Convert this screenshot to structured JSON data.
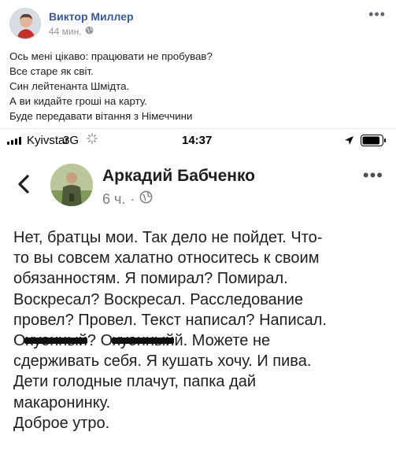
{
  "outer_post": {
    "author": "Виктор Миллер",
    "time": "44 мин.",
    "visibility_icon": "globe-icon",
    "more_icon": "more-horizontal-icon",
    "more_label": "•••",
    "lines": [
      "Ось мені цікаво: працювати не пробував?",
      "Все старе як світ.",
      "Син лейтенанта Шмідта.",
      "А ви кидайте гроші на карту.",
      "Буде передавати вітання з Німеччини"
    ]
  },
  "status_bar": {
    "carrier": "Kyivstar",
    "network": "3G",
    "time": "14:37",
    "signal_bars": 4,
    "battery_level": 0.9
  },
  "embedded_post": {
    "back_icon": "chevron-left-icon",
    "author": "Аркадий Бабченко",
    "time": "6 ч.",
    "separator": "·",
    "visibility_icon": "globe-icon",
    "more_label": "•••",
    "lines": [
      "Нет, братцы мои. Так дело не пойдет. Что-",
      "то вы совсем халатно относитесь к своим",
      "обязанностям. Я помирал? Помирал.",
      "Воскресал? Воскресал. Расследование",
      "провел? Провел. Текст написал? Написал."
    ],
    "censored_line": {
      "word1": "Охуенный",
      "mid": "? ",
      "word2": "Охуенный",
      "tail": "й. Можете не"
    },
    "lines_after": [
      "сдерживать себя. Я кушать хочу. И пива.",
      "Дети голодные плачут, папка дай",
      "макаронинку.",
      "Доброе утро."
    ]
  },
  "colors": {
    "link_blue": "#385898",
    "meta_gray": "#90949c",
    "text": "#1c1e21"
  }
}
